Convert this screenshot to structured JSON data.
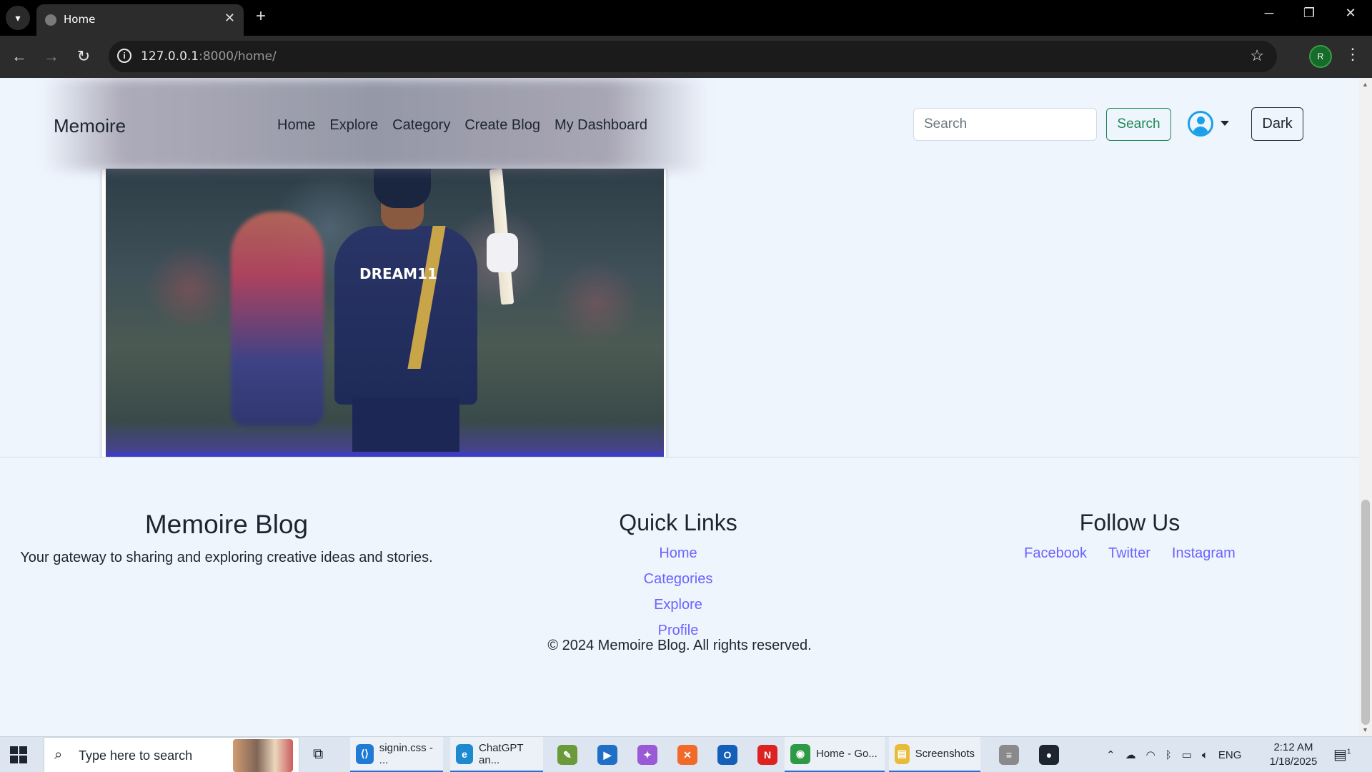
{
  "browser": {
    "tab_title": "Home",
    "url_host": "127.0.0.1",
    "url_rest": ":8000/home/",
    "profile_initial": "R"
  },
  "navbar": {
    "brand": "Memoire",
    "links": [
      "Home",
      "Explore",
      "Category",
      "Create Blog",
      "My Dashboard"
    ],
    "search_placeholder": "Search",
    "search_button": "Search",
    "theme_button": "Dark"
  },
  "post": {
    "jersey_text": "DREAM11"
  },
  "footer": {
    "about_title": "Memoire Blog",
    "about_text": "Your gateway to sharing and exploring creative ideas and stories.",
    "links_title": "Quick Links",
    "links": [
      "Home",
      "Categories",
      "Explore",
      "Profile"
    ],
    "follow_title": "Follow Us",
    "social": [
      "Facebook",
      "Twitter",
      "Instagram"
    ],
    "copyright": "© 2024 Memoire Blog. All rights reserved."
  },
  "taskbar": {
    "search_placeholder": "Type here to search",
    "apps": [
      {
        "label": "signin.css - ...",
        "icon": "vscode-icon",
        "color": "#1f7bd6",
        "glyph": "⟨⟩"
      },
      {
        "label": "ChatGPT an...",
        "icon": "edge-icon",
        "color": "#1d8ad0",
        "glyph": "e"
      },
      {
        "label": "",
        "icon": "paint-icon",
        "color": "#6a9a3a",
        "glyph": "✎"
      },
      {
        "label": "",
        "icon": "prime-video-icon",
        "color": "#1f6fc7",
        "glyph": "▶"
      },
      {
        "label": "",
        "icon": "copilot-icon",
        "color": "#9a5ad6",
        "glyph": "✦"
      },
      {
        "label": "",
        "icon": "xampp-icon",
        "color": "#f06a2a",
        "glyph": "✕"
      },
      {
        "label": "",
        "icon": "outlook-icon",
        "color": "#1460b8",
        "glyph": "O"
      },
      {
        "label": "",
        "icon": "netflix-icon",
        "color": "#dd2222",
        "glyph": "N"
      },
      {
        "label": "Home - Go...",
        "icon": "chrome-icon",
        "color": "#2f9a46",
        "glyph": "◉"
      },
      {
        "label": "Screenshots",
        "icon": "folder-icon",
        "color": "#e8bc3a",
        "glyph": "▤"
      },
      {
        "label": "",
        "icon": "database-icon",
        "color": "#8a8a8a",
        "glyph": "≡"
      },
      {
        "label": "",
        "icon": "github-icon",
        "color": "#1e2530",
        "glyph": "●"
      }
    ],
    "language": "ENG",
    "time": "2:12 AM",
    "date": "1/18/2025",
    "notification_count": "1"
  }
}
